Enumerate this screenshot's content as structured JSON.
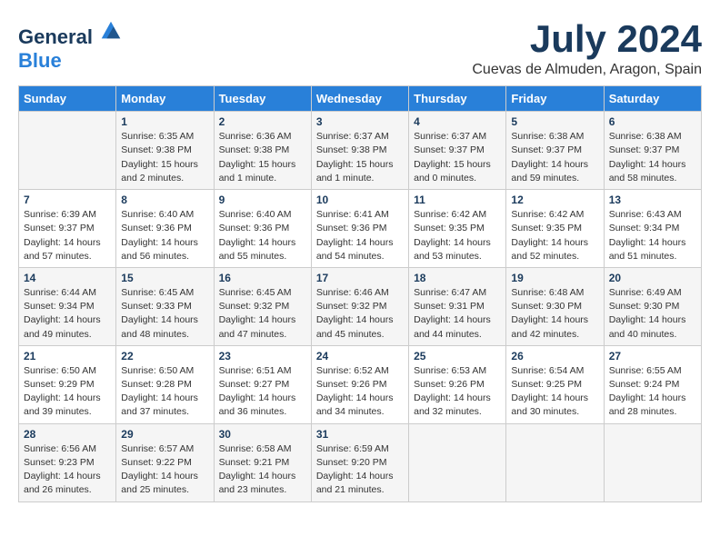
{
  "header": {
    "logo_general": "General",
    "logo_blue": "Blue",
    "month_title": "July 2024",
    "location": "Cuevas de Almuden, Aragon, Spain"
  },
  "weekdays": [
    "Sunday",
    "Monday",
    "Tuesday",
    "Wednesday",
    "Thursday",
    "Friday",
    "Saturday"
  ],
  "weeks": [
    [
      {
        "day": "",
        "sunrise": "",
        "sunset": "",
        "daylight": ""
      },
      {
        "day": "1",
        "sunrise": "Sunrise: 6:35 AM",
        "sunset": "Sunset: 9:38 PM",
        "daylight": "Daylight: 15 hours and 2 minutes."
      },
      {
        "day": "2",
        "sunrise": "Sunrise: 6:36 AM",
        "sunset": "Sunset: 9:38 PM",
        "daylight": "Daylight: 15 hours and 1 minute."
      },
      {
        "day": "3",
        "sunrise": "Sunrise: 6:37 AM",
        "sunset": "Sunset: 9:38 PM",
        "daylight": "Daylight: 15 hours and 1 minute."
      },
      {
        "day": "4",
        "sunrise": "Sunrise: 6:37 AM",
        "sunset": "Sunset: 9:37 PM",
        "daylight": "Daylight: 15 hours and 0 minutes."
      },
      {
        "day": "5",
        "sunrise": "Sunrise: 6:38 AM",
        "sunset": "Sunset: 9:37 PM",
        "daylight": "Daylight: 14 hours and 59 minutes."
      },
      {
        "day": "6",
        "sunrise": "Sunrise: 6:38 AM",
        "sunset": "Sunset: 9:37 PM",
        "daylight": "Daylight: 14 hours and 58 minutes."
      }
    ],
    [
      {
        "day": "7",
        "sunrise": "Sunrise: 6:39 AM",
        "sunset": "Sunset: 9:37 PM",
        "daylight": "Daylight: 14 hours and 57 minutes."
      },
      {
        "day": "8",
        "sunrise": "Sunrise: 6:40 AM",
        "sunset": "Sunset: 9:36 PM",
        "daylight": "Daylight: 14 hours and 56 minutes."
      },
      {
        "day": "9",
        "sunrise": "Sunrise: 6:40 AM",
        "sunset": "Sunset: 9:36 PM",
        "daylight": "Daylight: 14 hours and 55 minutes."
      },
      {
        "day": "10",
        "sunrise": "Sunrise: 6:41 AM",
        "sunset": "Sunset: 9:36 PM",
        "daylight": "Daylight: 14 hours and 54 minutes."
      },
      {
        "day": "11",
        "sunrise": "Sunrise: 6:42 AM",
        "sunset": "Sunset: 9:35 PM",
        "daylight": "Daylight: 14 hours and 53 minutes."
      },
      {
        "day": "12",
        "sunrise": "Sunrise: 6:42 AM",
        "sunset": "Sunset: 9:35 PM",
        "daylight": "Daylight: 14 hours and 52 minutes."
      },
      {
        "day": "13",
        "sunrise": "Sunrise: 6:43 AM",
        "sunset": "Sunset: 9:34 PM",
        "daylight": "Daylight: 14 hours and 51 minutes."
      }
    ],
    [
      {
        "day": "14",
        "sunrise": "Sunrise: 6:44 AM",
        "sunset": "Sunset: 9:34 PM",
        "daylight": "Daylight: 14 hours and 49 minutes."
      },
      {
        "day": "15",
        "sunrise": "Sunrise: 6:45 AM",
        "sunset": "Sunset: 9:33 PM",
        "daylight": "Daylight: 14 hours and 48 minutes."
      },
      {
        "day": "16",
        "sunrise": "Sunrise: 6:45 AM",
        "sunset": "Sunset: 9:32 PM",
        "daylight": "Daylight: 14 hours and 47 minutes."
      },
      {
        "day": "17",
        "sunrise": "Sunrise: 6:46 AM",
        "sunset": "Sunset: 9:32 PM",
        "daylight": "Daylight: 14 hours and 45 minutes."
      },
      {
        "day": "18",
        "sunrise": "Sunrise: 6:47 AM",
        "sunset": "Sunset: 9:31 PM",
        "daylight": "Daylight: 14 hours and 44 minutes."
      },
      {
        "day": "19",
        "sunrise": "Sunrise: 6:48 AM",
        "sunset": "Sunset: 9:30 PM",
        "daylight": "Daylight: 14 hours and 42 minutes."
      },
      {
        "day": "20",
        "sunrise": "Sunrise: 6:49 AM",
        "sunset": "Sunset: 9:30 PM",
        "daylight": "Daylight: 14 hours and 40 minutes."
      }
    ],
    [
      {
        "day": "21",
        "sunrise": "Sunrise: 6:50 AM",
        "sunset": "Sunset: 9:29 PM",
        "daylight": "Daylight: 14 hours and 39 minutes."
      },
      {
        "day": "22",
        "sunrise": "Sunrise: 6:50 AM",
        "sunset": "Sunset: 9:28 PM",
        "daylight": "Daylight: 14 hours and 37 minutes."
      },
      {
        "day": "23",
        "sunrise": "Sunrise: 6:51 AM",
        "sunset": "Sunset: 9:27 PM",
        "daylight": "Daylight: 14 hours and 36 minutes."
      },
      {
        "day": "24",
        "sunrise": "Sunrise: 6:52 AM",
        "sunset": "Sunset: 9:26 PM",
        "daylight": "Daylight: 14 hours and 34 minutes."
      },
      {
        "day": "25",
        "sunrise": "Sunrise: 6:53 AM",
        "sunset": "Sunset: 9:26 PM",
        "daylight": "Daylight: 14 hours and 32 minutes."
      },
      {
        "day": "26",
        "sunrise": "Sunrise: 6:54 AM",
        "sunset": "Sunset: 9:25 PM",
        "daylight": "Daylight: 14 hours and 30 minutes."
      },
      {
        "day": "27",
        "sunrise": "Sunrise: 6:55 AM",
        "sunset": "Sunset: 9:24 PM",
        "daylight": "Daylight: 14 hours and 28 minutes."
      }
    ],
    [
      {
        "day": "28",
        "sunrise": "Sunrise: 6:56 AM",
        "sunset": "Sunset: 9:23 PM",
        "daylight": "Daylight: 14 hours and 26 minutes."
      },
      {
        "day": "29",
        "sunrise": "Sunrise: 6:57 AM",
        "sunset": "Sunset: 9:22 PM",
        "daylight": "Daylight: 14 hours and 25 minutes."
      },
      {
        "day": "30",
        "sunrise": "Sunrise: 6:58 AM",
        "sunset": "Sunset: 9:21 PM",
        "daylight": "Daylight: 14 hours and 23 minutes."
      },
      {
        "day": "31",
        "sunrise": "Sunrise: 6:59 AM",
        "sunset": "Sunset: 9:20 PM",
        "daylight": "Daylight: 14 hours and 21 minutes."
      },
      {
        "day": "",
        "sunrise": "",
        "sunset": "",
        "daylight": ""
      },
      {
        "day": "",
        "sunrise": "",
        "sunset": "",
        "daylight": ""
      },
      {
        "day": "",
        "sunrise": "",
        "sunset": "",
        "daylight": ""
      }
    ]
  ]
}
